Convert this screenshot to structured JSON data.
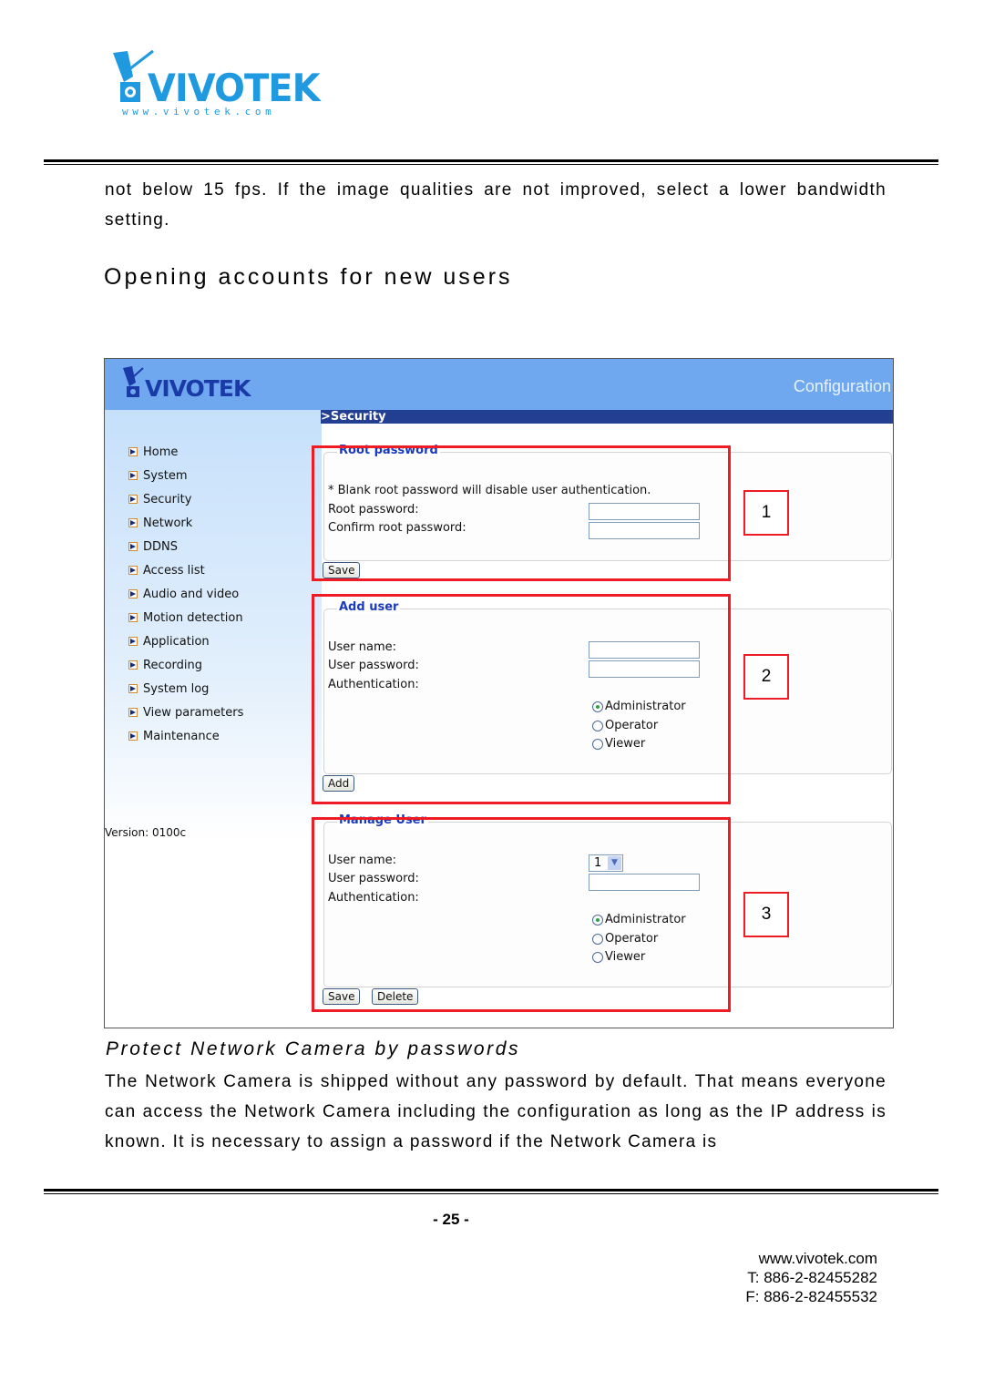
{
  "header": {
    "logo_text": "VIVOTEK",
    "logo_url_text": "www.vivotek.com"
  },
  "body": {
    "intro_paragraph": "not below 15 fps.  If the image qualities are not improved, select a lower bandwidth setting.",
    "section_title": "Opening accounts for new users"
  },
  "figure": {
    "app_logo": "VIVOTEK",
    "header_label": "Configuration",
    "breadcrumb": ">Security",
    "nav_items": [
      {
        "label": "Home"
      },
      {
        "label": "System"
      },
      {
        "label": "Security"
      },
      {
        "label": "Network"
      },
      {
        "label": "DDNS"
      },
      {
        "label": "Access list"
      },
      {
        "label": "Audio and video"
      },
      {
        "label": "Motion detection"
      },
      {
        "label": "Application"
      },
      {
        "label": "Recording"
      },
      {
        "label": "System log"
      },
      {
        "label": "View parameters"
      },
      {
        "label": "Maintenance"
      }
    ],
    "version": "Version: 0100c",
    "root_password": {
      "legend": "Root password",
      "note": "* Blank root password will disable user authentication.",
      "root_label": "Root password:",
      "confirm_label": "Confirm root password:",
      "root_value": "",
      "confirm_value": "",
      "save_label": "Save"
    },
    "add_user": {
      "legend": "Add user",
      "username_label": "User name:",
      "password_label": "User password:",
      "auth_label": "Authentication:",
      "username_value": "",
      "password_value": "",
      "options": [
        "Administrator",
        "Operator",
        "Viewer"
      ],
      "selected": "Administrator",
      "add_label": "Add"
    },
    "manage_user": {
      "legend": "Manage User",
      "username_label": "User name:",
      "password_label": "User password:",
      "auth_label": "Authentication:",
      "username_selected": "1",
      "password_value": "",
      "options": [
        "Administrator",
        "Operator",
        "Viewer"
      ],
      "selected": "Administrator",
      "save_label": "Save",
      "delete_label": "Delete"
    },
    "callouts": [
      "1",
      "2",
      "3"
    ],
    "highlight_color": "#ee1c24",
    "header_color": "#6fa8ef",
    "breadcrumb_bar_color": "#233f91"
  },
  "caption": "Protect Network Camera by passwords",
  "paragraph2": "The Network Camera is shipped without any password by default. That means everyone can access the Network Camera including the configuration as long as the IP address is known. It is necessary to assign a password if the Network Camera is",
  "footer": {
    "page_number": "- 25 -",
    "website": "www.vivotek.com",
    "phone": "T: 886-2-82455282",
    "fax": "F: 886-2-82455532"
  }
}
